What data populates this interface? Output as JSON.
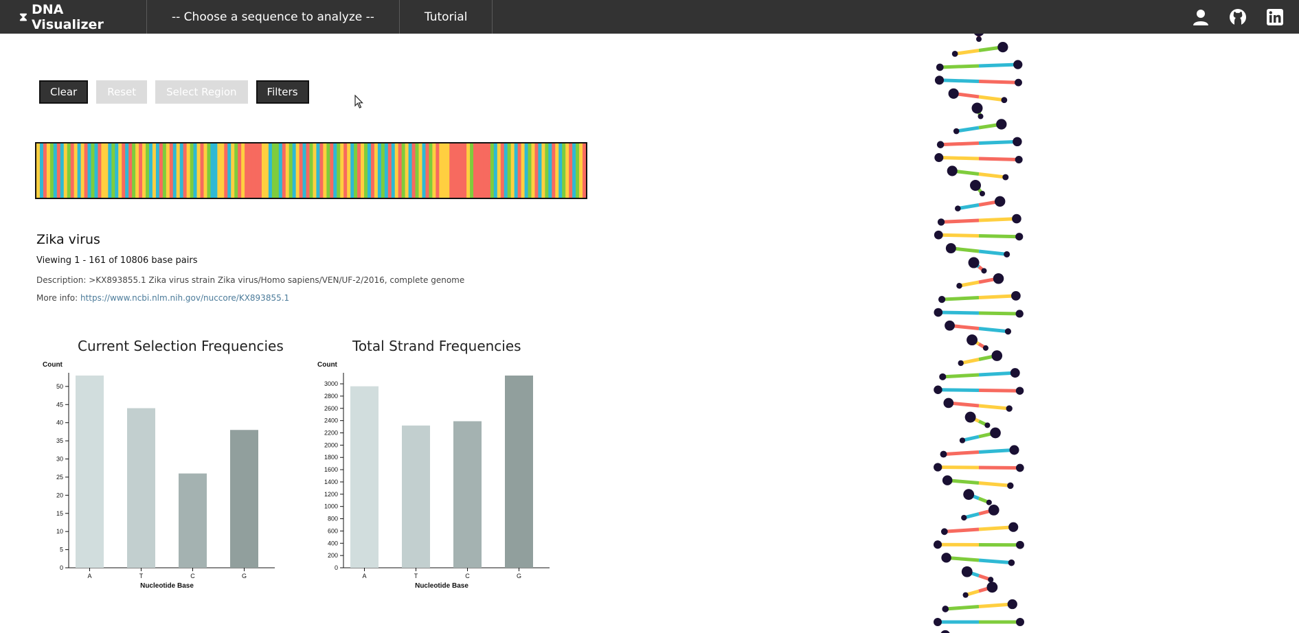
{
  "nav": {
    "brand": "DNA Visualizer",
    "sequence_select": "-- Choose a sequence to analyze --",
    "tutorial": "Tutorial",
    "icons": [
      "user-icon",
      "github-icon",
      "linkedin-icon"
    ]
  },
  "toolbar": {
    "clear": "Clear",
    "reset": "Reset",
    "select_region": "Select Region",
    "filters": "Filters"
  },
  "colors": {
    "A": "#ffcf40",
    "T": "#f76a5f",
    "C": "#2fb9d4",
    "G": "#7fcc3c",
    "nav_bg": "#333333",
    "node": "#1a1033"
  },
  "sequence": {
    "organism": "Zika virus",
    "viewing": "Viewing 1 - 161 of 10806 base pairs",
    "description": "Description: >KX893855.1 Zika virus strain Zika virus/Homo sapiens/VEN/UF-2/2016, complete genome",
    "more_info_label": "More info: ",
    "more_info_link": "https://www.ncbi.nlm.nih.gov/nuccore/KX893855.1"
  },
  "chart_data": [
    {
      "type": "bar",
      "title": "Current Selection Frequencies",
      "xlabel": "Nucleotide Base",
      "ylabel": "Count",
      "categories": [
        "A",
        "T",
        "C",
        "G"
      ],
      "values": [
        53,
        44,
        26,
        38
      ],
      "ylim": [
        0,
        53
      ],
      "yticks": [
        0,
        5,
        10,
        15,
        20,
        25,
        30,
        35,
        40,
        45,
        50
      ],
      "bar_colors": [
        "#d1dddd",
        "#c2cfcf",
        "#a4b2b1",
        "#919f9d"
      ]
    },
    {
      "type": "bar",
      "title": "Total Strand Frequencies",
      "xlabel": "Nucleotide Base",
      "ylabel": "Count",
      "categories": [
        "A",
        "T",
        "C",
        "G"
      ],
      "values": [
        2960,
        2320,
        2390,
        3135
      ],
      "ylim": [
        0,
        3135
      ],
      "yticks": [
        0,
        200,
        400,
        600,
        800,
        1000,
        1200,
        1400,
        1600,
        1800,
        2000,
        2200,
        2400,
        2600,
        2800,
        3000
      ],
      "bar_colors": [
        "#d1dddd",
        "#c2cfcf",
        "#a4b2b1",
        "#919f9d"
      ]
    }
  ]
}
